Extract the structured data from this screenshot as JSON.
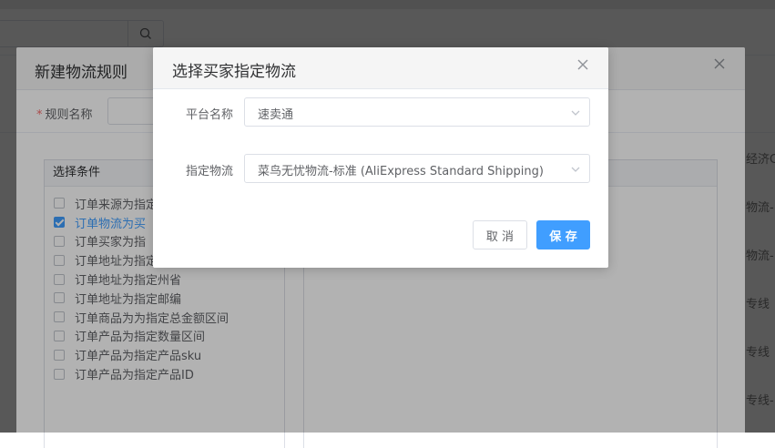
{
  "background": {
    "side_texts": [
      "经济C",
      "物流-",
      "物流-",
      "专线",
      "专线",
      "专线-"
    ]
  },
  "rule_dialog": {
    "title": "新建物流规则",
    "required_mark": "*",
    "rule_name_label": "规则名称",
    "conditions_header": "选择条件",
    "conditions": [
      {
        "label": "订单来源为指定",
        "checked": false
      },
      {
        "label": "订单物流为买",
        "checked": true
      },
      {
        "label": "订单买家为指",
        "checked": false
      },
      {
        "label": "订单地址为指定国家/地区",
        "checked": false
      },
      {
        "label": "订单地址为指定州省",
        "checked": false
      },
      {
        "label": "订单地址为指定邮编",
        "checked": false
      },
      {
        "label": "订单商品为为指定总金额区间",
        "checked": false
      },
      {
        "label": "订单产品为指定数量区间",
        "checked": false
      },
      {
        "label": "订单产品为指定产品sku",
        "checked": false
      },
      {
        "label": "订单产品为指定产品ID",
        "checked": false
      }
    ]
  },
  "logistics_dialog": {
    "title": "选择买家指定物流",
    "platform_label": "平台名称",
    "platform_value": "速卖通",
    "logistics_label": "指定物流",
    "logistics_value": "菜鸟无忧物流-标准 (AliExpress Standard Shipping)",
    "cancel_label": "取 消",
    "save_label": "保 存"
  },
  "colors": {
    "primary": "#409eff",
    "required": "#f56c6c"
  }
}
